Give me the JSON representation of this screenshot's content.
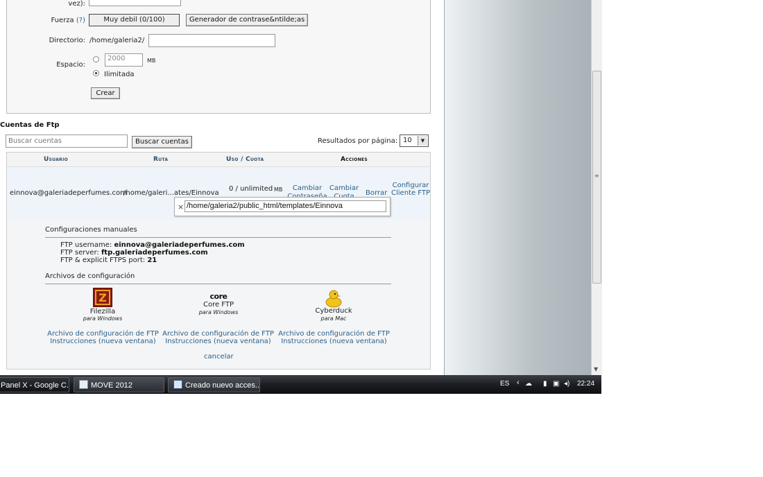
{
  "form": {
    "partial_label": "vez):",
    "strength_label": "Fuerza",
    "strength_help": "(?)",
    "strength_value": "Muy debil (0/100)",
    "generator_button": "Generador de contrase&ntilde;as",
    "directory_label": "Directorio:",
    "directory_prefix": "/home/galeria2/",
    "space_label": "Espacio:",
    "quota_value": "2000",
    "quota_unit": "MB",
    "unlimited_label": "Ilimitada",
    "create_button": "Crear"
  },
  "ftp": {
    "section_title": "Cuentas de Ftp",
    "search_placeholder": "Buscar cuentas",
    "search_button": "Buscar cuentas",
    "per_page_label": "Resultados por página:",
    "per_page_value": "10",
    "columns": [
      "Usuario",
      "Ruta",
      "Uso / Cuota",
      "Acciones"
    ],
    "row": {
      "user": "einnova@galeriadeperfumes.com",
      "path": "/home/galeri...ates/Einnova",
      "usage": "0 / unlimited",
      "usage_unit": "MB",
      "change_password": "Cambiar Contraseña",
      "change_quota": "Cambiar Cuota",
      "delete": "Borrar",
      "configure": "Configurar Cliente FTP"
    },
    "popup": {
      "close": "×",
      "full_path": "/home/galeria2/public_html/templates/Einnova"
    },
    "manual": {
      "title": "Configuraciones manuales",
      "username_label": "FTP username:",
      "username_value": "einnova@galeriadeperfumes.com",
      "server_label": "FTP server:",
      "server_value": "ftp.galeriadeperfumes.com",
      "port_label": "FTP & explicit FTPS port:",
      "port_value": "21"
    },
    "config_files": {
      "title": "Archivos de configuración",
      "clients": [
        {
          "name": "Filezilla",
          "platform": "para Windows",
          "file_link": "Archivo de configuración de FTP",
          "instructions_link": "Instrucciones (nueva ventana)"
        },
        {
          "name": "Core FTP",
          "logo_text": "core",
          "platform": "para Windows",
          "file_link": "Archivo de configuración de FTP",
          "instructions_link": "Instrucciones (nueva ventana)"
        },
        {
          "name": "Cyberduck",
          "platform": "para Mac",
          "file_link": "Archivo de configuración de FTP",
          "instructions_link": "Instrucciones (nueva ventana)"
        }
      ],
      "cancel": "cancelar"
    }
  },
  "taskbar": {
    "tasks": [
      "Panel X - Google C...",
      "MOVE 2012",
      "Creado nuevo acces..."
    ],
    "language": "ES",
    "clock": "22:24"
  }
}
